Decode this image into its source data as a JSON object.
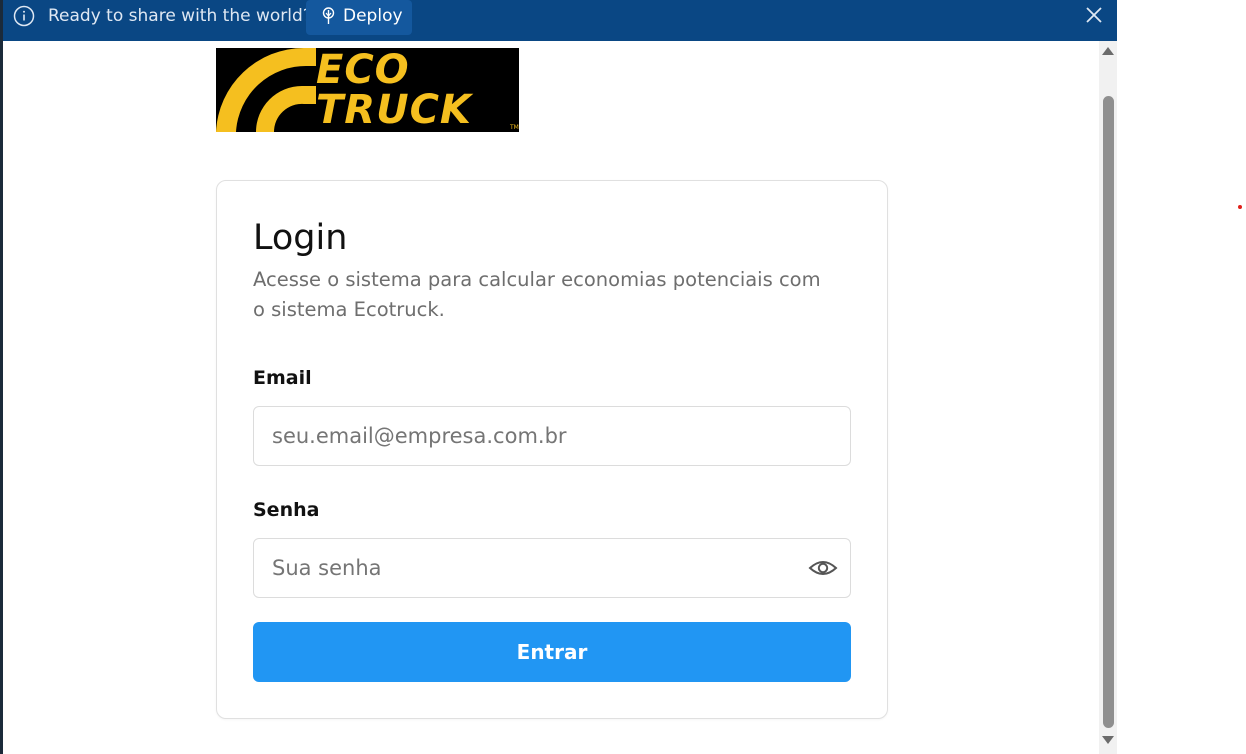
{
  "banner": {
    "message": "Ready to share with the world?",
    "deploy_label": "Deploy",
    "info_icon": "info-icon",
    "deploy_icon": "deploy-icon",
    "close_icon": "close-icon",
    "background": "#0a4784"
  },
  "logo": {
    "line1": "ECO",
    "line2": "TRUCK",
    "tm": "TM",
    "color": "#f5bf1f"
  },
  "login": {
    "title": "Login",
    "subtitle": "Acesse o sistema para calcular economias potenciais com o sistema Ecotruck.",
    "email_label": "Email",
    "email_placeholder": "seu.email@empresa.com.br",
    "password_label": "Senha",
    "password_placeholder": "Sua senha",
    "password_toggle_icon": "eye-icon",
    "submit_label": "Entrar",
    "accent": "#2196f3"
  }
}
